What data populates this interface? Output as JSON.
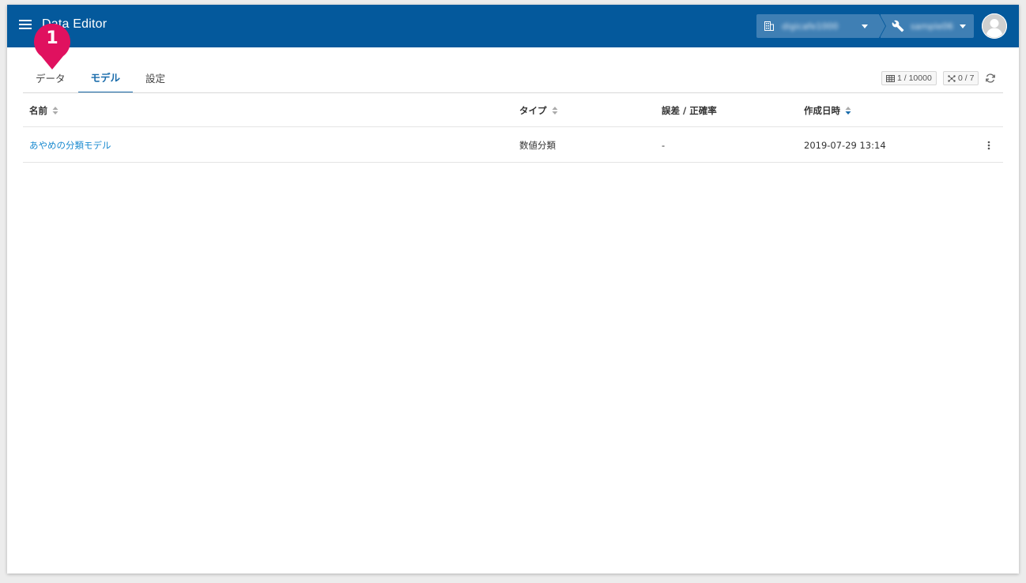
{
  "app": {
    "title": "Data Editor"
  },
  "header": {
    "org_name": "digicafe1000",
    "project_name": "sample06"
  },
  "callout": {
    "number": "1"
  },
  "tabs": [
    {
      "label": "データ"
    },
    {
      "label": "モデル"
    },
    {
      "label": "設定"
    }
  ],
  "toolbar": {
    "rows_badge": "1 / 10000",
    "models_badge": "0 / 7"
  },
  "table": {
    "columns": [
      "名前",
      "タイプ",
      "誤差 / 正確率",
      "作成日時"
    ],
    "rows": [
      {
        "name": "あやめの分類モデル",
        "type": "数値分類",
        "error": "-",
        "created": "2019-07-29 13:14"
      }
    ]
  },
  "colors": {
    "header_bg": "#04599c",
    "accent": "#1a6cab",
    "link": "#1b8bd0",
    "callout": "#e0115f"
  }
}
